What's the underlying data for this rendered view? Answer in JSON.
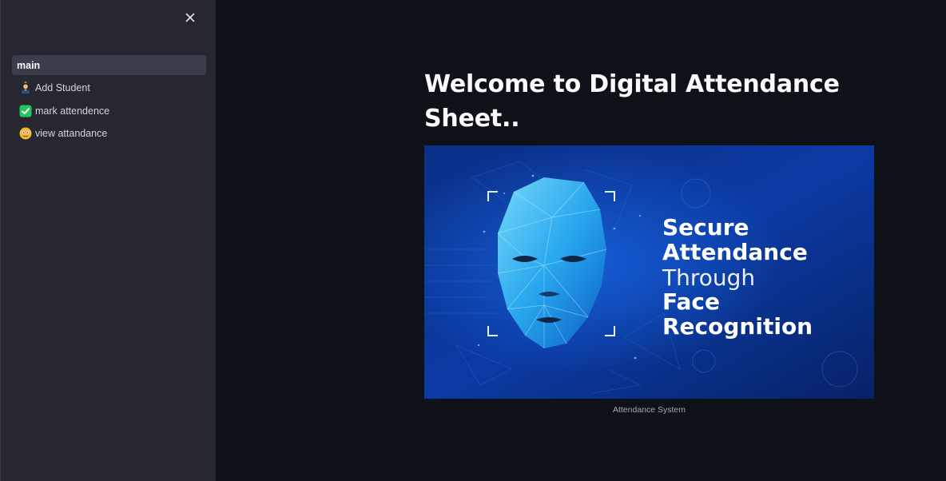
{
  "sidebar": {
    "close_label": "×",
    "items": [
      {
        "label": "main",
        "active": true,
        "icon": ""
      },
      {
        "label": "Add Student",
        "active": false,
        "icon": "student-icon"
      },
      {
        "label": "mark attendence",
        "active": false,
        "icon": "check-icon"
      },
      {
        "label": "view attandance",
        "active": false,
        "icon": "smiley-icon"
      }
    ]
  },
  "main": {
    "title": "Welcome to Digital Attendance Sheet..",
    "image": {
      "lines": [
        "Secure",
        "Attendance",
        "Through",
        "Face",
        "Recognition"
      ]
    },
    "caption": "Attendance System"
  },
  "colors": {
    "background": "#0e1117",
    "sidebar": "#262730",
    "active_item": "#3b3d4a",
    "text": "#fafafa",
    "check_green": "#22c55e"
  }
}
